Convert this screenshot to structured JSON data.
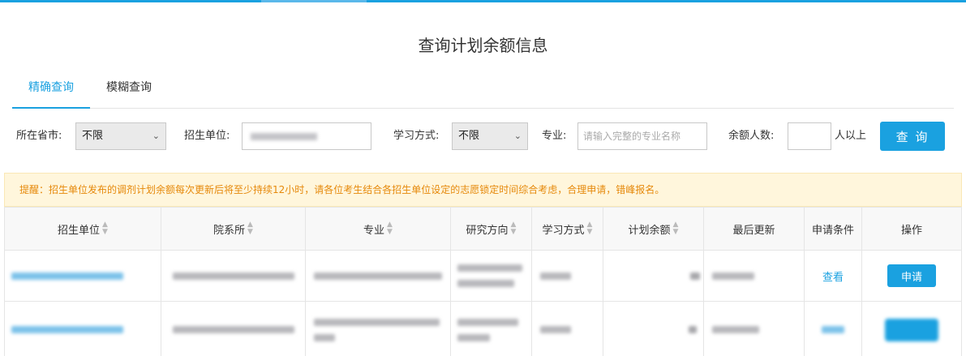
{
  "page_title": "查询计划余额信息",
  "tabs": [
    {
      "label": "精确查询",
      "active": true
    },
    {
      "label": "模糊查询",
      "active": false
    }
  ],
  "filters": {
    "province_label": "所在省市:",
    "province_value": "不限",
    "unit_label": "招生单位:",
    "study_mode_label": "学习方式:",
    "study_mode_value": "不限",
    "major_label": "专业:",
    "major_placeholder": "请输入完整的专业名称",
    "quota_label": "余额人数:",
    "quota_suffix": "人以上",
    "search_label": "查 询"
  },
  "notice": "提醒：招生单位发布的调剂计划余额每次更新后将至少持续12小时，请各位考生结合各招生单位设定的志愿锁定时间综合考虑，合理申请，错峰报名。",
  "table": {
    "headers": [
      "招生单位",
      "院系所",
      "专业",
      "研究方向",
      "学习方式",
      "计划余额",
      "最后更新",
      "申请条件",
      "操作"
    ],
    "rows": [
      {
        "condition_link": "查看",
        "action_label": "申请"
      },
      {}
    ]
  },
  "colors": {
    "accent": "#1aa1e0",
    "notice_text": "#e6890b",
    "notice_bg": "#fff6dc"
  }
}
